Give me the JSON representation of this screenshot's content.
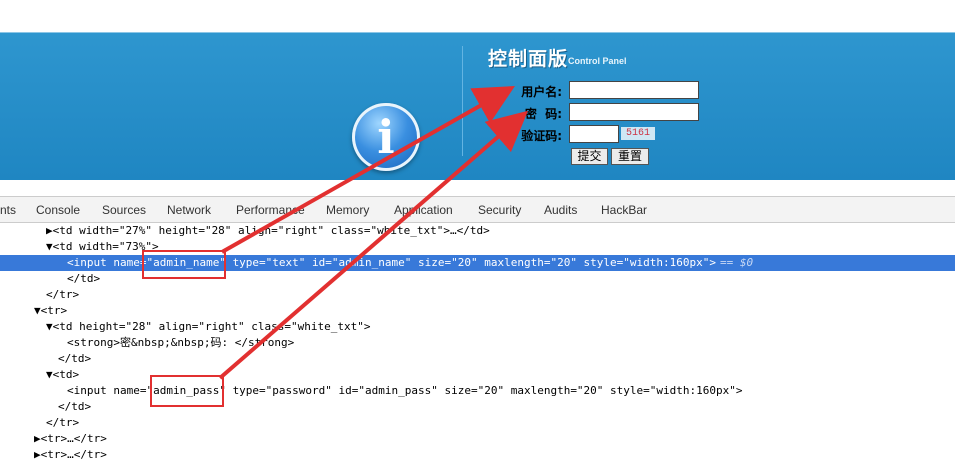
{
  "panel": {
    "title": "控制面版",
    "subtitle": "Control Panel",
    "info_glyph": "i",
    "labels": {
      "username": "用户名:",
      "password": "密  码:",
      "captcha": "验证码:"
    },
    "captcha_text": "5161",
    "submit_label": "提交",
    "reset_label": "重置"
  },
  "devtools": {
    "tabs": [
      "nts",
      "Console",
      "Sources",
      "Network",
      "Performance",
      "Memory",
      "Application",
      "Security",
      "Audits",
      "HackBar"
    ],
    "dom_lines": [
      "▶<td width=\"27%\" height=\"28\" align=\"right\" class=\"white_txt\">…</td>",
      "▼<td width=\"73%\">",
      "<input name=\"admin_name\" type=\"text\" id=\"admin_name\" size=\"20\" maxlength=\"20\" style=\"width:160px\">",
      "== $0",
      "</td>",
      "</tr>",
      "▼<tr>",
      "▼<td height=\"28\" align=\"right\" class=\"white_txt\">",
      "<strong>密&nbsp;&nbsp;码: </strong>",
      "</td>",
      "▼<td>",
      "<input name=\"admin_pass\" type=\"password\" id=\"admin_pass\" size=\"20\" maxlength=\"20\" style=\"width:160px\">",
      "</td>",
      "</tr>",
      "▶<tr>…</tr>",
      "▶<tr>…</tr>"
    ]
  },
  "colors": {
    "panel_blue": "#1f86c2",
    "highlight_red": "#e23030",
    "selection_blue": "#3879d9"
  }
}
